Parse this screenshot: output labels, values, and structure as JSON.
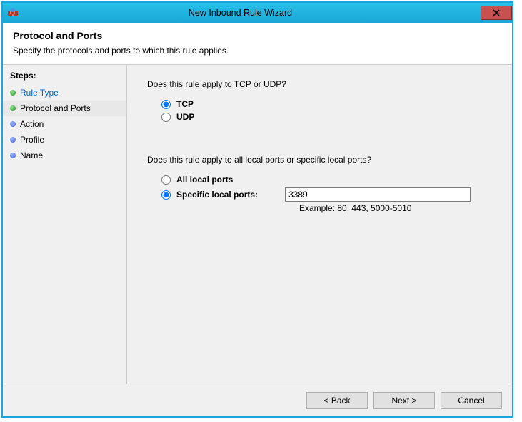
{
  "window": {
    "title": "New Inbound Rule Wizard"
  },
  "header": {
    "heading": "Protocol and Ports",
    "subtext": "Specify the protocols and ports to which this rule applies."
  },
  "sidebar": {
    "label": "Steps:",
    "items": [
      {
        "label": "Rule Type",
        "state": "completed"
      },
      {
        "label": "Protocol and Ports",
        "state": "current"
      },
      {
        "label": "Action",
        "state": "pending"
      },
      {
        "label": "Profile",
        "state": "pending"
      },
      {
        "label": "Name",
        "state": "pending"
      }
    ]
  },
  "main": {
    "q1": "Does this rule apply to TCP or UDP?",
    "tcp_label": "TCP",
    "udp_label": "UDP",
    "protocol_selected": "tcp",
    "q2": "Does this rule apply to all local ports or specific local ports?",
    "all_ports_label": "All local ports",
    "specific_ports_label": "Specific local ports:",
    "ports_scope_selected": "specific",
    "ports_value": "3389",
    "example_text": "Example: 80, 443, 5000-5010"
  },
  "footer": {
    "back": "< Back",
    "next": "Next >",
    "cancel": "Cancel"
  }
}
